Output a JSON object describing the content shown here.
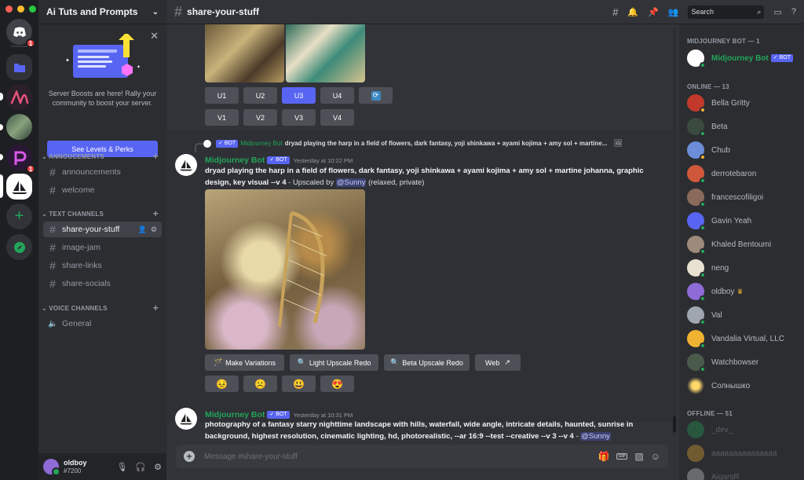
{
  "app": {
    "server_name": "Ai Tuts and Prompts",
    "channel_name": "share-your-stuff",
    "search_placeholder": "Search",
    "message_placeholder": "Message #share-your-stuff"
  },
  "rail": {
    "home_badge": "1",
    "purple_badge": "1"
  },
  "boost": {
    "text": "Server Boosts are here! Rally your community to boost your server.",
    "button": "See Levels & Perks"
  },
  "categories": {
    "announcements": "ANNOUCEMENTS",
    "text": "TEXT CHANNELS",
    "voice": "VOICE CHANNELS"
  },
  "channels": {
    "announcements": "announcements",
    "welcome": "welcome",
    "share_your_stuff": "share-your-stuff",
    "image_jam": "image-jam",
    "share_links": "share-links",
    "share_socials": "share-socials",
    "general": "General"
  },
  "user": {
    "name": "oldboy",
    "tag": "#7200"
  },
  "upscale_buttons": [
    "U1",
    "U2",
    "U3",
    "U4"
  ],
  "variation_buttons": [
    "V1",
    "V2",
    "V3",
    "V4"
  ],
  "messages": {
    "reply_preview": "dryad playing the harp in a field of flowers, dark fantasy, yoji shinkawa + ayami kojima + amy sol + martine...",
    "bot_name": "Midjourney Bot",
    "bot_badge": "BOT",
    "msg1_time": "Yesterday at 10:22 PM",
    "msg1_prompt": "dryad playing the harp in a field of flowers, dark fantasy, yoji shinkawa + ayami kojima + amy sol + martine johanna, graphic design, key visual --v 4",
    "msg1_suffix": " - Upscaled by ",
    "msg1_mention": "@Sunny",
    "msg1_tail": " (relaxed, private)",
    "action_make_variations": "Make Variations",
    "action_light_upscale": "Light Upscale Redo",
    "action_beta_upscale": "Beta Upscale Redo",
    "action_web": "Web",
    "msg2_time": "Yesterday at 10:31 PM",
    "msg2_prompt": "photography of a fantasy starry nighttime landscape with hills, waterfall, wide angle, intricate details, haunted, sunrise in background, highest resolution, cinematic lighting, hd, photorealistic, --ar 16:9 --test --creative --v 3 --v 4",
    "msg2_suffix": " - ",
    "msg2_mention": "@Sunny",
    "reactions": [
      "😣",
      "☹️",
      "😃",
      "😍"
    ]
  },
  "members": {
    "bot_header": "MIDJOURNEY BOT — 1",
    "online_header": "ONLINE — 13",
    "offline_header": "OFFLINE — 51",
    "bot": "Midjourney Bot",
    "bot_badge": "BOT",
    "online": [
      "Bella Gritty",
      "Beta",
      "Chub",
      "derrotebaron",
      "francescofiligoi",
      "Gavin Yeah",
      "Khaled Bentoumi",
      "neng",
      "oldboy",
      "Val",
      "Vandalia Virtual, LLC",
      "Watchbowser",
      "Солнышко"
    ],
    "offline": [
      "_dev_",
      "aaaaaaaaaaaaaaa",
      "AigarsR"
    ]
  },
  "colors": {
    "accent": "#5865f2",
    "bot_name": "#23a559",
    "online": "#23a55a",
    "idle": "#f0b232",
    "badge_red": "#f23f43"
  }
}
